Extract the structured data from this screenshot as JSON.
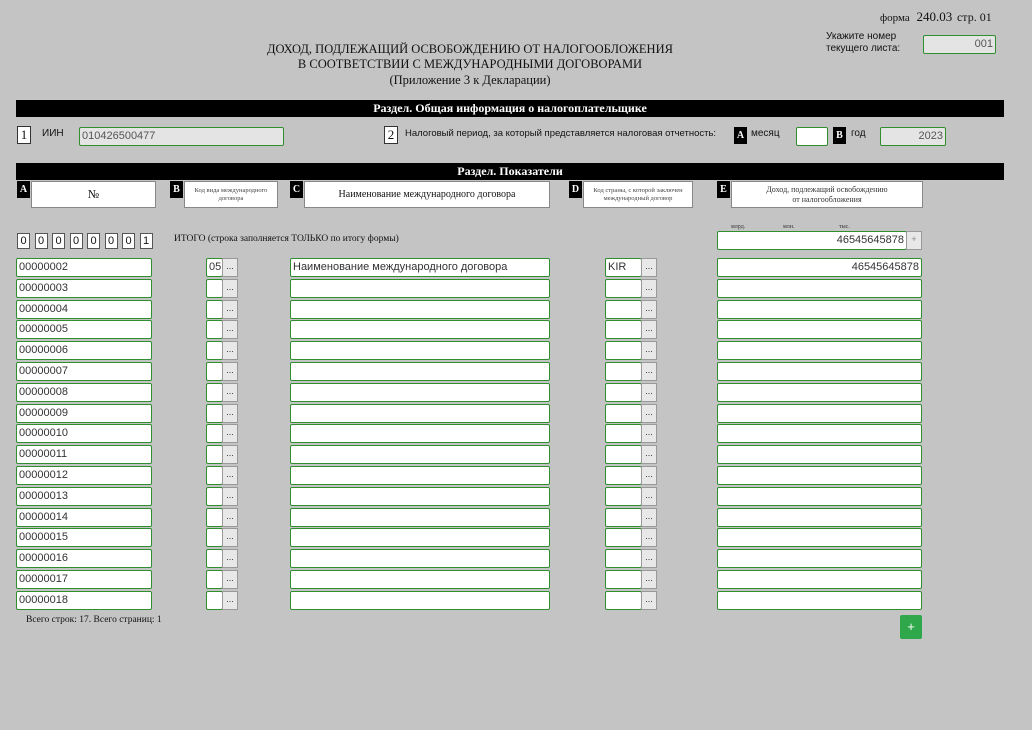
{
  "form": {
    "label": "форма",
    "code": "240.03",
    "page": "стр. 01"
  },
  "sheet": {
    "label_line1": "Укажите номер",
    "label_line2": "текущего листа:",
    "value": "001"
  },
  "title": {
    "line1": "ДОХОД, ПОДЛЕЖАЩИЙ ОСВОБОЖДЕНИЮ ОТ НАЛОГООБЛОЖЕНИЯ",
    "line2": "В СООТВЕТСТВИИ С МЕЖДУНАРОДНЫМИ ДОГОВОРАМИ",
    "line3": "(Приложение 3 к Декларации)"
  },
  "section_general": {
    "title": "Раздел. Общая информация о налогоплательщике",
    "field1_num": "1",
    "iin_label": "ИИН",
    "iin_value": "010426500477",
    "field2_num": "2",
    "period_label": "Налоговый период, за который представляется налоговая отчетность:",
    "month_letter": "A",
    "month_label": "месяц",
    "month_value": "",
    "year_letter": "B",
    "year_label": "год",
    "year_value": "2023"
  },
  "section_indicators": {
    "title": "Раздел. Показатели",
    "columns": [
      {
        "letter": "A",
        "label": "№"
      },
      {
        "letter": "B",
        "label": "Код вида международного договора"
      },
      {
        "letter": "C",
        "label": "Наименование международного договора"
      },
      {
        "letter": "D",
        "label": "Код страны, с которой заключен международный договор"
      },
      {
        "letter": "E",
        "label_line1": "Доход, подлежащий освобождению",
        "label_line2": "от налогообложения"
      }
    ],
    "units": {
      "bn": "млрд.",
      "mn": "млн.",
      "th": "тыс."
    },
    "total_digits": [
      "0",
      "0",
      "0",
      "0",
      "0",
      "0",
      "0",
      "1"
    ],
    "total_label": "ИТОГО (строка заполняется ТОЛЬКО по итогу формы)",
    "total_value": "46545645878",
    "total_button": "+",
    "dots_label": "...",
    "rows": [
      {
        "num": "00000002",
        "code": "05",
        "name": "Наименование международного договора",
        "country": "KIR",
        "income": "46545645878"
      },
      {
        "num": "00000003",
        "code": "",
        "name": "",
        "country": "",
        "income": ""
      },
      {
        "num": "00000004",
        "code": "",
        "name": "",
        "country": "",
        "income": ""
      },
      {
        "num": "00000005",
        "code": "",
        "name": "",
        "country": "",
        "income": ""
      },
      {
        "num": "00000006",
        "code": "",
        "name": "",
        "country": "",
        "income": ""
      },
      {
        "num": "00000007",
        "code": "",
        "name": "",
        "country": "",
        "income": ""
      },
      {
        "num": "00000008",
        "code": "",
        "name": "",
        "country": "",
        "income": ""
      },
      {
        "num": "00000009",
        "code": "",
        "name": "",
        "country": "",
        "income": ""
      },
      {
        "num": "00000010",
        "code": "",
        "name": "",
        "country": "",
        "income": ""
      },
      {
        "num": "00000011",
        "code": "",
        "name": "",
        "country": "",
        "income": ""
      },
      {
        "num": "00000012",
        "code": "",
        "name": "",
        "country": "",
        "income": ""
      },
      {
        "num": "00000013",
        "code": "",
        "name": "",
        "country": "",
        "income": ""
      },
      {
        "num": "00000014",
        "code": "",
        "name": "",
        "country": "",
        "income": ""
      },
      {
        "num": "00000015",
        "code": "",
        "name": "",
        "country": "",
        "income": ""
      },
      {
        "num": "00000016",
        "code": "",
        "name": "",
        "country": "",
        "income": ""
      },
      {
        "num": "00000017",
        "code": "",
        "name": "",
        "country": "",
        "income": ""
      },
      {
        "num": "00000018",
        "code": "",
        "name": "",
        "country": "",
        "income": ""
      }
    ]
  },
  "footer": {
    "summary": "Всего строк: 17. Всего страниц: 1",
    "add_button": "+"
  },
  "colors": {
    "field_border": "#2f8f2f",
    "add_button": "#2ea84a",
    "background": "#c4c4c4"
  }
}
